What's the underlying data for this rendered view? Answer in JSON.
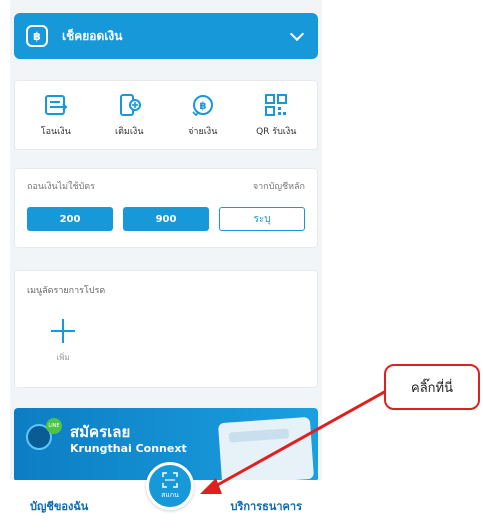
{
  "balance": {
    "icon": "baht-icon",
    "label": "เช็คยอดเงิน",
    "toggle_icon": "chevron-down-icon"
  },
  "quick_actions": [
    {
      "label": "โอนเงิน",
      "icon": "transfer-icon"
    },
    {
      "label": "เติมเงิน",
      "icon": "topup-icon"
    },
    {
      "label": "จ่ายเงิน",
      "icon": "pay-icon"
    },
    {
      "label": "QR รับเงิน",
      "icon": "qr-icon"
    }
  ],
  "withdraw": {
    "title": "ถอนเงินไม่ใช้บัตร",
    "source": "จากบัญชีหลัก",
    "amounts": [
      "200",
      "900",
      "ระบุ"
    ]
  },
  "favorites": {
    "title": "เมนูลัดรายการโปรด",
    "add_label": "เพิ่ม"
  },
  "promo": {
    "title": "สมัครเลย",
    "subtitle": "Krungthai Connext",
    "badge": "LINE"
  },
  "bottom_nav": {
    "left": "บัญชีของฉัน",
    "scan": "สแกน",
    "right": "บริการธนาคาร"
  },
  "annotation": {
    "text": "คลิ๊กที่นี่",
    "color": "#e02020"
  },
  "colors": {
    "primary": "#1798d9"
  }
}
